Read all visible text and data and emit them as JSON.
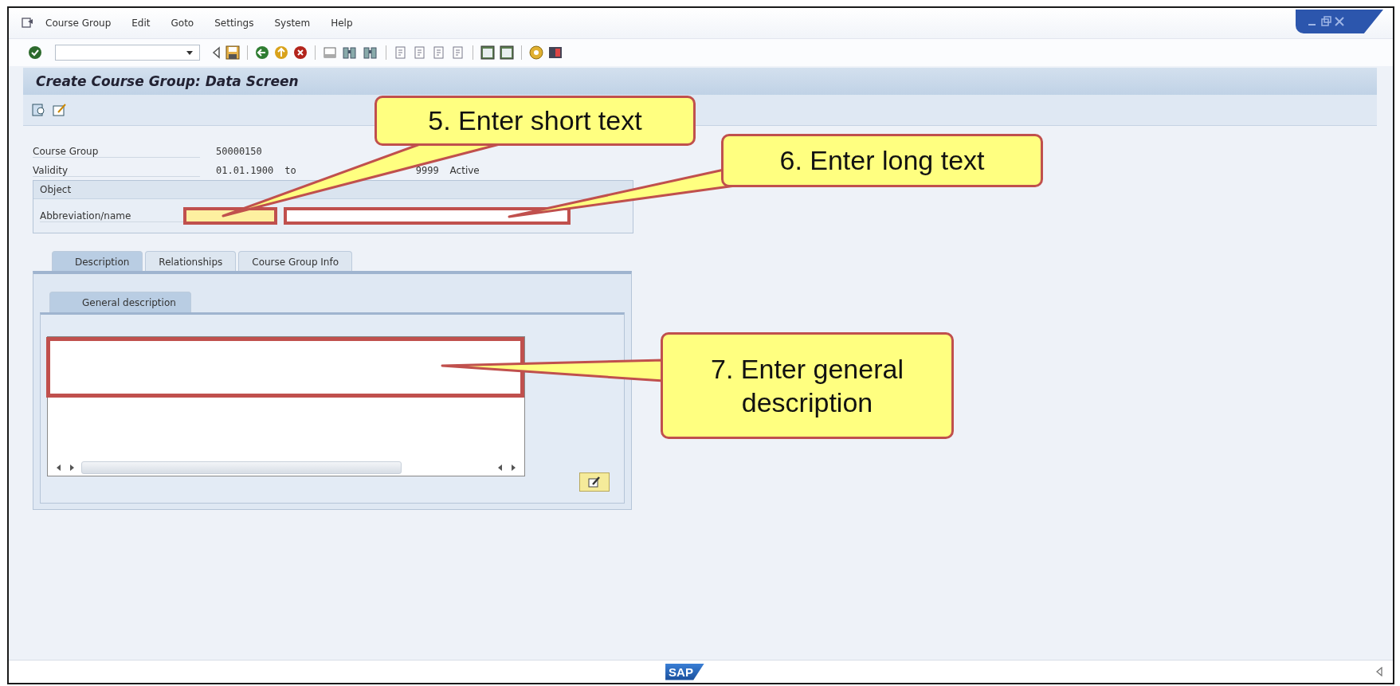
{
  "menu": [
    {
      "label": "Course Group"
    },
    {
      "label": "Edit"
    },
    {
      "label": "Goto"
    },
    {
      "label": "Settings"
    },
    {
      "label": "System"
    },
    {
      "label": "Help"
    }
  ],
  "screen_title": "Create Course Group: Data Screen",
  "course_group": {
    "label": "Course Group",
    "value": "50000150"
  },
  "validity": {
    "label": "Validity",
    "from": "01.01.1900",
    "to_label": "to",
    "until": "9999",
    "status": "Active"
  },
  "object_group": {
    "title": "Object",
    "label": "Abbreviation/name",
    "short_field": {
      "required": true,
      "highlighted": true
    },
    "long_field": {
      "required": false,
      "highlighted": true
    }
  },
  "tabs": [
    {
      "label": "Description",
      "selected": true
    },
    {
      "label": "Relationships",
      "selected": false
    },
    {
      "label": "Course Group Info",
      "selected": false
    }
  ],
  "subtabs": [
    {
      "label": "General description",
      "selected": true
    }
  ],
  "description_editor": {
    "highlighted": true
  },
  "callouts": [
    {
      "text": "5. Enter short text"
    },
    {
      "text": "6. Enter long text"
    },
    {
      "text": "7. Enter general description"
    }
  ],
  "status_bar": {
    "logo": "SAP"
  }
}
